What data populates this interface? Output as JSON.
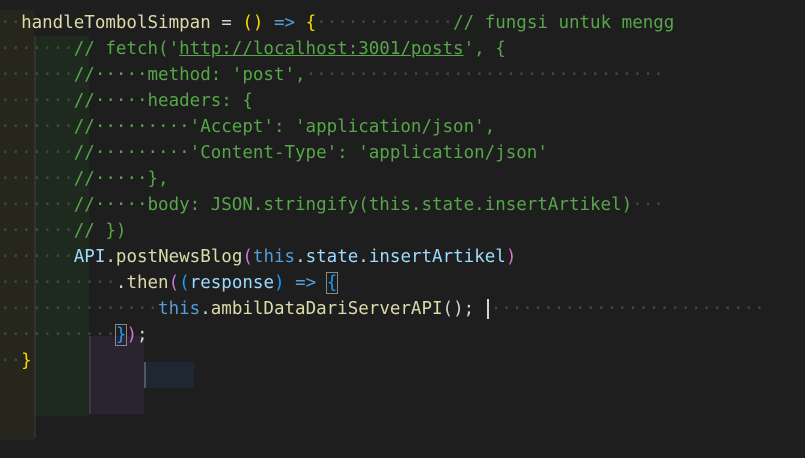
{
  "editor": {
    "language": "javascript",
    "cursor_line": 13
  },
  "lines": [
    {
      "tokens": [
        {
          "t": "··",
          "c": "ws"
        },
        {
          "t": "handleTombolSimpan",
          "c": "fn"
        },
        {
          "t": " = ",
          "c": "op"
        },
        {
          "t": "()",
          "c": "yellow-brace"
        },
        {
          "t": " => ",
          "c": "kw"
        },
        {
          "t": "{",
          "c": "yellow-brace"
        },
        {
          "t": "·············",
          "c": "ws"
        },
        {
          "t": "// fungsi untuk mengg",
          "c": "cm"
        }
      ]
    },
    {
      "tokens": [
        {
          "t": "·······",
          "c": "ws"
        },
        {
          "t": "// fetch('",
          "c": "cm"
        },
        {
          "t": "http://localhost:3001/posts",
          "c": "cm url"
        },
        {
          "t": "', {",
          "c": "cm"
        }
      ]
    },
    {
      "tokens": [
        {
          "t": "·······",
          "c": "ws"
        },
        {
          "t": "//·····method: 'post',",
          "c": "cm"
        },
        {
          "t": "··································",
          "c": "ws"
        }
      ]
    },
    {
      "tokens": [
        {
          "t": "·······",
          "c": "ws"
        },
        {
          "t": "//·····headers: {",
          "c": "cm"
        }
      ]
    },
    {
      "tokens": [
        {
          "t": "·······",
          "c": "ws"
        },
        {
          "t": "//·········'Accept': 'application/json',",
          "c": "cm"
        }
      ]
    },
    {
      "tokens": [
        {
          "t": "·······",
          "c": "ws"
        },
        {
          "t": "//·········'Content-Type': 'application/json'",
          "c": "cm"
        }
      ]
    },
    {
      "tokens": [
        {
          "t": "·······",
          "c": "ws"
        },
        {
          "t": "//·····},",
          "c": "cm"
        }
      ]
    },
    {
      "tokens": [
        {
          "t": "·······",
          "c": "ws"
        },
        {
          "t": "//·····body: JSON.stringify(this.state.insertArtikel)",
          "c": "cm"
        },
        {
          "t": "···",
          "c": "ws"
        }
      ]
    },
    {
      "tokens": [
        {
          "t": "·······",
          "c": "ws"
        },
        {
          "t": "// })",
          "c": "cm"
        }
      ]
    },
    {
      "tokens": [
        {
          "t": "·······",
          "c": "ws"
        },
        {
          "t": "API",
          "c": "var"
        },
        {
          "t": ".",
          "c": "plain"
        },
        {
          "t": "postNewsBlog",
          "c": "fn"
        },
        {
          "t": "(",
          "c": "purple-brace"
        },
        {
          "t": "this",
          "c": "kw"
        },
        {
          "t": ".",
          "c": "plain"
        },
        {
          "t": "state",
          "c": "var"
        },
        {
          "t": ".",
          "c": "plain"
        },
        {
          "t": "insertArtikel",
          "c": "var"
        },
        {
          "t": ")",
          "c": "purple-brace"
        }
      ]
    },
    {
      "tokens": [
        {
          "t": "···········",
          "c": "ws"
        },
        {
          "t": ".",
          "c": "plain"
        },
        {
          "t": "then",
          "c": "fn"
        },
        {
          "t": "(",
          "c": "purple-brace"
        },
        {
          "t": "(",
          "c": "blue-brace"
        },
        {
          "t": "response",
          "c": "var"
        },
        {
          "t": ")",
          "c": "blue-brace"
        },
        {
          "t": " => ",
          "c": "kw"
        },
        {
          "t": "{",
          "c": "blue-brace brace-box"
        }
      ]
    },
    {
      "tokens": [
        {
          "t": "···············",
          "c": "ws"
        },
        {
          "t": "this",
          "c": "kw"
        },
        {
          "t": ".",
          "c": "plain"
        },
        {
          "t": "ambilDataDariServerAPI",
          "c": "fn"
        },
        {
          "t": "();",
          "c": "plain"
        },
        {
          "t": " ",
          "c": "plain"
        },
        {
          "t": "|CURSOR|",
          "c": "cursor"
        },
        {
          "t": "··························",
          "c": "ws"
        }
      ]
    },
    {
      "tokens": [
        {
          "t": "···········",
          "c": "ws"
        },
        {
          "t": "}",
          "c": "blue-brace brace-box"
        },
        {
          "t": ")",
          "c": "purple-brace"
        },
        {
          "t": ";",
          "c": "plain"
        }
      ]
    },
    {
      "tokens": [
        {
          "t": "··",
          "c": "ws"
        },
        {
          "t": "}",
          "c": "yellow-brace"
        }
      ]
    }
  ]
}
